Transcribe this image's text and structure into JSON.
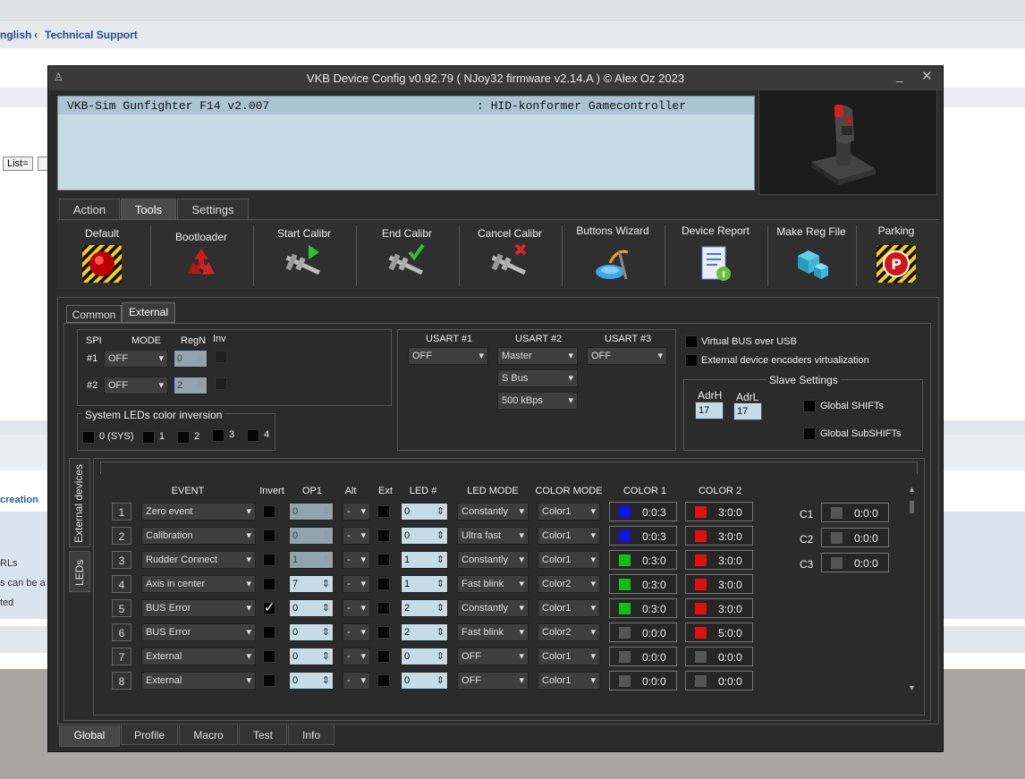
{
  "background_page": {
    "crumb_lang": "nglish",
    "crumb_sep": "‹",
    "crumb_support": "Technical Support",
    "list_button": "List=",
    "section_label": "creation",
    "line1": "RLs",
    "line2": "s can be a",
    "line3": "ted"
  },
  "window": {
    "title": "VKB Device Config v0.92.79 ( NJoy32 firmware v2.14.A ) © Alex Oz 2023",
    "min_glyph": "_",
    "close_glyph": "✕"
  },
  "device": {
    "name": "VKB-Sim Gunfighter F14  v2.007",
    "type": ": HID-konformer Gamecontroller"
  },
  "top_tabs": [
    "Action",
    "Tools",
    "Settings"
  ],
  "tools": [
    {
      "label": "Default",
      "icon": "red-button-icon"
    },
    {
      "label": "Bootloader",
      "icon": "recycle-icon"
    },
    {
      "label": "Start Calibr",
      "icon": "caliper-play-icon"
    },
    {
      "label": "End Calibr",
      "icon": "caliper-check-icon"
    },
    {
      "label": "Cancel Calibr",
      "icon": "caliper-cancel-icon"
    },
    {
      "label": "Buttons Wizard",
      "icon": "wizard-icon"
    },
    {
      "label": "Device Report",
      "icon": "report-icon"
    },
    {
      "label": "Make Reg File",
      "icon": "registry-icon"
    },
    {
      "label": "Parking",
      "icon": "parking-icon"
    }
  ],
  "sub_tabs": [
    "Common",
    "External"
  ],
  "spi": {
    "headers": {
      "spi": "SPI",
      "mode": "MODE",
      "regn": "RegN",
      "inv": "Inv"
    },
    "rows": [
      {
        "label": "#1",
        "mode": "OFF",
        "regn": "0"
      },
      {
        "label": "#2",
        "mode": "OFF",
        "regn": "2"
      }
    ]
  },
  "sys_leds": {
    "title": "System LEDs color inversion",
    "items": [
      "0 (SYS)",
      "1",
      "2",
      "3",
      "4"
    ]
  },
  "usart": {
    "headers": [
      "USART #1",
      "USART #2",
      "USART #3"
    ],
    "u1": "OFF",
    "u2_mode": "Master",
    "u2_bus": "S Bus",
    "u2_speed": "500 kBps",
    "u3": "OFF"
  },
  "virtual": {
    "bus_usb": "Virtual BUS over USB",
    "encoders": "External device encoders virtualization"
  },
  "slave": {
    "title": "Slave Settings",
    "adrh_label": "AdrH",
    "adrl_label": "AdrL",
    "adrh": "17",
    "adrl": "17",
    "global_shifts": "Global SHIFTs",
    "global_subshifts": "Global SubSHIFTs"
  },
  "side_tabs": [
    "External devices",
    "LEDs"
  ],
  "led_table": {
    "headers": {
      "event": "EVENT",
      "invert": "Invert",
      "op1": "OP1",
      "alt": "Alt",
      "ext": "Ext",
      "led": "LED #",
      "led_mode": "LED MODE",
      "color_mode": "COLOR MODE",
      "color1": "COLOR 1",
      "color2": "COLOR 2"
    },
    "rows": [
      {
        "n": "1",
        "event": "Zero event",
        "invert": false,
        "op1": "0",
        "alt": "-",
        "led": "0",
        "led_mode": "Constantly",
        "color_mode": "Color1",
        "c1": "0:0:3",
        "c1_color": "#1010e0",
        "c2": "3:0:0",
        "c2_color": "#e01010"
      },
      {
        "n": "2",
        "event": "Calibration",
        "invert": false,
        "op1": "0",
        "alt": "-",
        "led": "0",
        "led_mode": "Ultra fast",
        "color_mode": "Color1",
        "c1": "0:0:3",
        "c1_color": "#1010e0",
        "c2": "3:0:0",
        "c2_color": "#e01010"
      },
      {
        "n": "3",
        "event": "Rudder Connect",
        "invert": false,
        "op1": "1",
        "alt": "-",
        "led": "1",
        "led_mode": "Constantly",
        "color_mode": "Color1",
        "c1": "0:3:0",
        "c1_color": "#10c010",
        "c2": "3:0:0",
        "c2_color": "#e01010"
      },
      {
        "n": "4",
        "event": "Axis in center",
        "invert": false,
        "op1": "7",
        "alt": "-",
        "led": "1",
        "led_mode": "Fast blink",
        "color_mode": "Color2",
        "c1": "0:3:0",
        "c1_color": "#10c010",
        "c2": "3:0:0",
        "c2_color": "#e01010"
      },
      {
        "n": "5",
        "event": "BUS Error",
        "invert": true,
        "op1": "0",
        "alt": "-",
        "led": "2",
        "led_mode": "Constantly",
        "color_mode": "Color1",
        "c1": "0:3:0",
        "c1_color": "#10c010",
        "c2": "3:0:0",
        "c2_color": "#e01010"
      },
      {
        "n": "6",
        "event": "BUS Error",
        "invert": false,
        "op1": "0",
        "alt": "-",
        "led": "2",
        "led_mode": "Fast blink",
        "color_mode": "Color2",
        "c1": "0:0:0",
        "c1_color": "#555555",
        "c2": "5:0:0",
        "c2_color": "#e01010"
      },
      {
        "n": "7",
        "event": "External",
        "invert": false,
        "op1": "0",
        "alt": "-",
        "led": "0",
        "led_mode": "OFF",
        "color_mode": "Color1",
        "c1": "0:0:0",
        "c1_color": "#555555",
        "c2": "0:0:0",
        "c2_color": "#555555"
      },
      {
        "n": "8",
        "event": "External",
        "invert": false,
        "op1": "0",
        "alt": "-",
        "led": "0",
        "led_mode": "OFF",
        "color_mode": "Color1",
        "c1": "0:0:0",
        "c1_color": "#555555",
        "c2": "0:0:0",
        "c2_color": "#555555"
      }
    ],
    "custom_colors": [
      {
        "label": "C1",
        "value": "0:0:0"
      },
      {
        "label": "C2",
        "value": "0:0:0"
      },
      {
        "label": "C3",
        "value": "0:0:0"
      }
    ]
  },
  "bottom_tabs": [
    "Global",
    "Profile",
    "Macro",
    "Test",
    "Info"
  ],
  "check_glyph": "✓"
}
